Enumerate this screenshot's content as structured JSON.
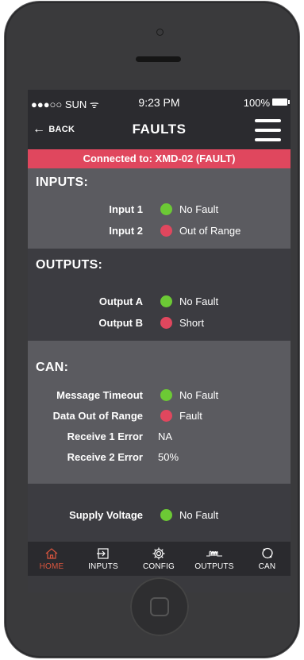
{
  "status_bar": {
    "carrier": "●●●○○ SUN  ᯤ",
    "time": "9:23 PM",
    "battery": "100%"
  },
  "nav": {
    "back_label": "BACK",
    "title": "FAULTS"
  },
  "banner": "Connected to: XMD-02 (FAULT)",
  "colors": {
    "ok": "#6cc935",
    "fault": "#e0475e",
    "banner": "#e0475e",
    "active_tab": "#d9553e"
  },
  "inputs": {
    "title": "INPUTS:",
    "rows": [
      {
        "label": "Input 1",
        "status": "ok",
        "value": "No Fault"
      },
      {
        "label": "Input 2",
        "status": "fault",
        "value": "Out of Range"
      }
    ]
  },
  "outputs": {
    "title": "OUTPUTS:",
    "rows": [
      {
        "label": "Output A",
        "status": "ok",
        "value": "No Fault"
      },
      {
        "label": "Output B",
        "status": "fault",
        "value": "Short"
      }
    ]
  },
  "can": {
    "title": "CAN:",
    "rows": [
      {
        "label": "Message Timeout",
        "status": "ok",
        "value": "No Fault"
      },
      {
        "label": "Data Out of Range",
        "status": "fault",
        "value": "Fault"
      },
      {
        "label": "Receive 1 Error",
        "status": "none",
        "value": "NA"
      },
      {
        "label": "Receive 2 Error",
        "status": "none",
        "value": "50%"
      }
    ]
  },
  "supply": {
    "rows": [
      {
        "label": "Supply Voltage",
        "status": "ok",
        "value": "No Fault"
      }
    ]
  },
  "tabs": [
    {
      "label": "HOME",
      "icon": "home-icon",
      "active": true
    },
    {
      "label": "INPUTS",
      "icon": "input-icon",
      "active": false
    },
    {
      "label": "CONFIG",
      "icon": "gear-icon",
      "active": false
    },
    {
      "label": "OUTPUTS",
      "icon": "waveform-icon",
      "active": false
    },
    {
      "label": "CAN",
      "icon": "network-icon",
      "active": false
    }
  ]
}
